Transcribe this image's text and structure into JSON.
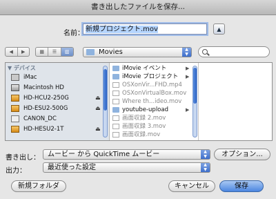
{
  "window": {
    "title": "書き出したファイルを保存..."
  },
  "save_as": {
    "label": "名前：",
    "value": "新規プロジェクト.mov"
  },
  "toolbar": {
    "back_glyph": "◀",
    "forward_glyph": "▶",
    "view_modes": [
      "icon",
      "list",
      "column"
    ],
    "location": "Movies"
  },
  "sidebar": {
    "section": "▼ デバイス",
    "items": [
      {
        "label": "iMac",
        "icon": "imac-icon",
        "eject": false
      },
      {
        "label": "Macintosh HD",
        "icon": "hard-disk-icon",
        "eject": false
      },
      {
        "label": "HD-HCU2-250G",
        "icon": "external-disk-icon",
        "eject": true
      },
      {
        "label": "HD-ESU2-500G",
        "icon": "external-disk-icon",
        "eject": true
      },
      {
        "label": "CANON_DC",
        "icon": "camera-icon",
        "eject": false
      },
      {
        "label": "HD-HESU2-1T",
        "icon": "external-disk-icon",
        "eject": true
      }
    ],
    "eject_glyph": "⏏"
  },
  "column1": [
    {
      "label": "iMovie イベント",
      "kind": "folder",
      "chevron": true,
      "dim": false
    },
    {
      "label": "iMovie プロジェクト",
      "kind": "folder",
      "chevron": true,
      "dim": false
    },
    {
      "label": "OSXonVir...FHD.mp4",
      "kind": "file",
      "chevron": false,
      "dim": true
    },
    {
      "label": "OSXonVirtualBox.mov",
      "kind": "file",
      "chevron": false,
      "dim": true
    },
    {
      "label": "Where th...ideo.mov",
      "kind": "file",
      "chevron": false,
      "dim": true
    },
    {
      "label": "youtube-upload",
      "kind": "folder",
      "chevron": true,
      "dim": false
    },
    {
      "label": "画面収録 2.mov",
      "kind": "file",
      "chevron": false,
      "dim": true
    },
    {
      "label": "画面収録 3.mov",
      "kind": "file",
      "chevron": false,
      "dim": true
    },
    {
      "label": "画面収録.mov",
      "kind": "file",
      "chevron": false,
      "dim": true
    }
  ],
  "export": {
    "label": "書き出し：",
    "value": "ムービー から QuickTime ムービー",
    "options_button": "オプション..."
  },
  "output": {
    "label": "出力：",
    "value": "最近使った設定"
  },
  "buttons": {
    "new_folder": "新規フォルダ",
    "cancel": "キャンセル",
    "save": "保存"
  }
}
